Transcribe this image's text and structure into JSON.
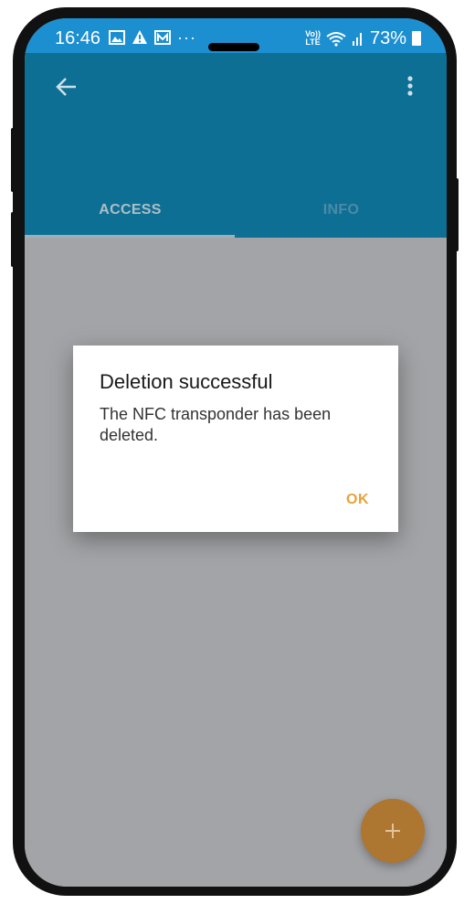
{
  "status_bar": {
    "time": "16:46",
    "dots": "···",
    "volte_line1": "Vo))",
    "volte_line2": "LTE",
    "battery": "73%",
    "icons": [
      "image-icon",
      "warning-icon",
      "mail-icon",
      "wifi-icon",
      "signal-icon",
      "battery-icon"
    ]
  },
  "app_bar": {
    "back_icon": "arrow-left-icon",
    "menu_icon": "more-vert-icon",
    "tabs": [
      {
        "label": "ACCESS",
        "selected": true
      },
      {
        "label": "INFO",
        "selected": false
      }
    ]
  },
  "dialog": {
    "title": "Deletion successful",
    "message": "The NFC transponder has been deleted.",
    "ok_label": "OK"
  },
  "fab": {
    "icon": "plus-icon"
  },
  "colors": {
    "status_bar": "#1c8fd0",
    "app_bar": "#0e6f95",
    "overlay": "#a3a4a7",
    "accent": "#e7a33a",
    "fab": "#ad7631"
  }
}
